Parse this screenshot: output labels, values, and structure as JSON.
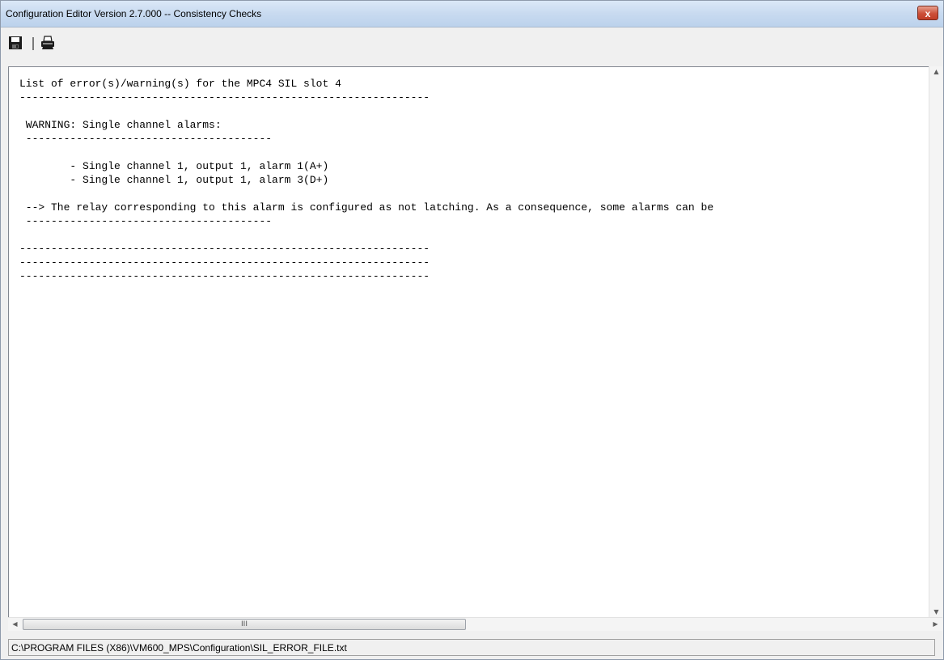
{
  "window": {
    "title": "Configuration Editor Version 2.7.000 -- Consistency Checks",
    "close_label": "x"
  },
  "toolbar": {
    "save_icon": "floppy-disk-icon",
    "print_icon": "printer-icon"
  },
  "report": {
    "lines": [
      "List of error(s)/warning(s) for the MPC4 SIL slot 4",
      "-----------------------------------------------------------------",
      "",
      " WARNING: Single channel alarms:",
      " ---------------------------------------",
      "",
      "        - Single channel 1, output 1, alarm 1(A+)",
      "        - Single channel 1, output 1, alarm 3(D+)",
      "",
      " --> The relay corresponding to this alarm is configured as not latching. As a consequence, some alarms can be",
      " ---------------------------------------",
      "",
      "-----------------------------------------------------------------",
      "-----------------------------------------------------------------",
      "-----------------------------------------------------------------"
    ]
  },
  "scrollbars": {
    "h_grip": "III"
  },
  "status": {
    "file_path": "C:\\PROGRAM FILES (X86)\\VM600_MPS\\Configuration\\SIL_ERROR_FILE.txt"
  }
}
